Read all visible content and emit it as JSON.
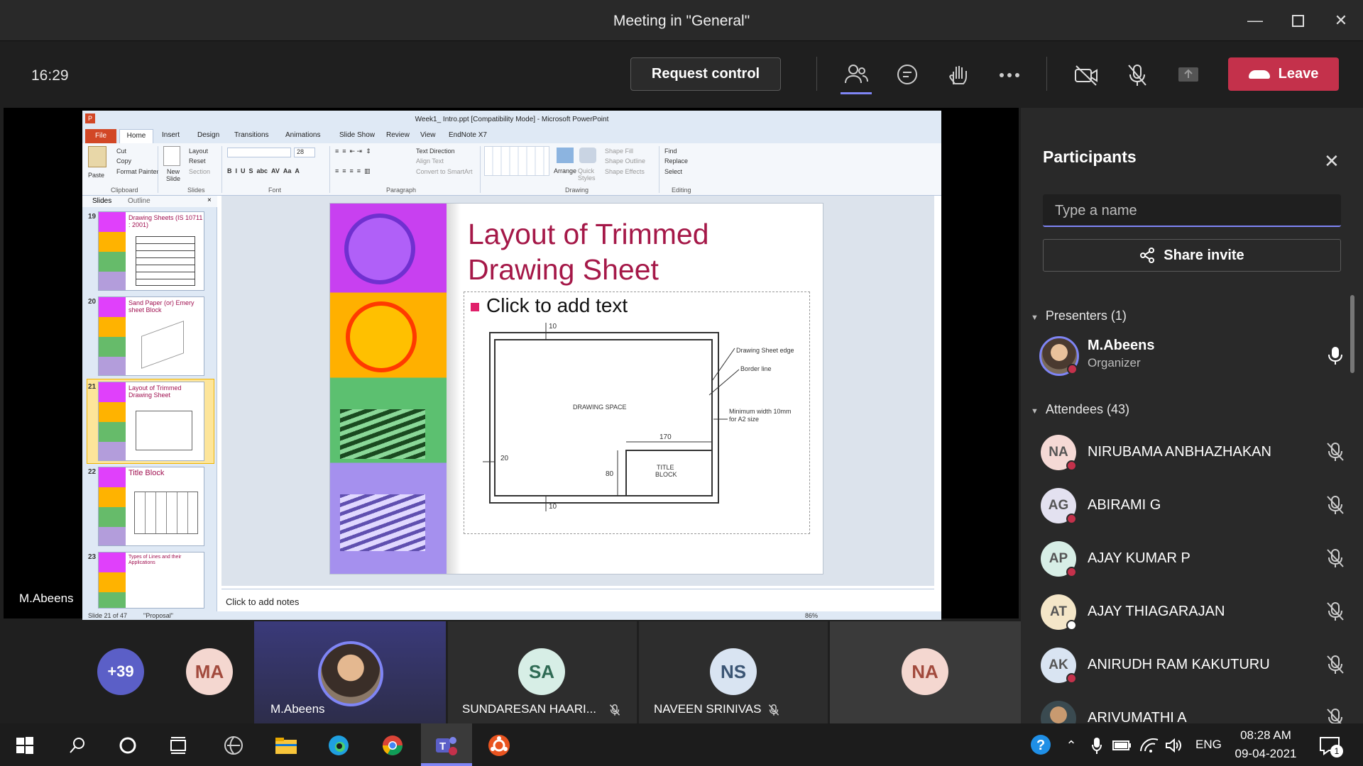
{
  "window": {
    "title": "Meeting in \"General\""
  },
  "toolbar": {
    "time": "16:29",
    "request_control": "Request control",
    "leave": "Leave"
  },
  "stage": {
    "presenter_label": "M.Abeens"
  },
  "ppt": {
    "window_title": "Week1_ Intro.ppt [Compatibility Mode] - Microsoft PowerPoint",
    "tabs": [
      "File",
      "Home",
      "Insert",
      "Design",
      "Transitions",
      "Animations",
      "Slide Show",
      "Review",
      "View",
      "EndNote X7"
    ],
    "ribbon": {
      "paste": "Paste",
      "cut": "Cut",
      "copy": "Copy",
      "format_painter": "Format Painter",
      "new_slide": "New Slide",
      "layout": "Layout",
      "reset": "Reset",
      "section": "Section",
      "font_size": "28",
      "text_direction": "Text Direction",
      "align_text": "Align Text",
      "convert_smartart": "Convert to SmartArt",
      "arrange": "Arrange",
      "quick_styles": "Quick Styles",
      "shape_fill": "Shape Fill",
      "shape_outline": "Shape Outline",
      "shape_effects": "Shape Effects",
      "find": "Find",
      "replace": "Replace",
      "select": "Select",
      "groups": {
        "clipboard": "Clipboard",
        "slides": "Slides",
        "font": "Font",
        "paragraph": "Paragraph",
        "drawing": "Drawing",
        "editing": "Editing"
      }
    },
    "panel_tabs": {
      "slides": "Slides",
      "outline": "Outline"
    },
    "thumbs": [
      {
        "num": "19",
        "title": "Drawing Sheets (IS 10711 : 2001)"
      },
      {
        "num": "20",
        "title": "Sand Paper (or) Emery sheet Block"
      },
      {
        "num": "21",
        "title": "Layout of Trimmed Drawing Sheet"
      },
      {
        "num": "22",
        "title": "Title Block"
      },
      {
        "num": "23",
        "title": "Types of Lines and their Applications"
      }
    ],
    "slide": {
      "title_line1": "Layout of Trimmed",
      "title_line2": "Drawing Sheet",
      "bullet": "Click to add text",
      "drawing": {
        "top_margin": "10",
        "bottom_margin": "10",
        "left_margin": "20",
        "space": "DRAWING SPACE",
        "edge": "Drawing Sheet edge",
        "border": "Border line",
        "min_width_1": "Minimum width 10mm",
        "min_width_2": "for A2 size",
        "title_block_1": "TITLE",
        "title_block_2": "BLOCK",
        "tb_width": "170",
        "tb_height": "80"
      }
    },
    "notes": "Click to add notes",
    "status_slide": "Slide 21 of 47",
    "status_theme": "\"Proposal\"",
    "zoom": "86%"
  },
  "participants": {
    "header": "Participants",
    "search_placeholder": "Type a name",
    "share_invite": "Share invite",
    "presenters_label": "Presenters (1)",
    "presenter": {
      "name": "M.Abeens",
      "role": "Organizer"
    },
    "attendees_label": "Attendees (43)",
    "attendees": [
      {
        "initials": "NA",
        "name": "NIRUBAMA ANBHAZHAKAN",
        "color": "#f5d9d5",
        "status": "#c4314b"
      },
      {
        "initials": "AG",
        "name": "ABIRAMI G",
        "color": "#e3e1f0",
        "status": "#c4314b"
      },
      {
        "initials": "AP",
        "name": "AJAY KUMAR P",
        "color": "#d7eee6",
        "status": "#c4314b"
      },
      {
        "initials": "AT",
        "name": "AJAY THIAGARAJAN",
        "color": "#f4e6c8",
        "status": "#ffffff"
      },
      {
        "initials": "AK",
        "name": "ANIRUDH RAM KAKUTURU",
        "color": "#d9e4f2",
        "status": "#c4314b"
      },
      {
        "initials": "",
        "name": "ARIVUMATHI A",
        "color": "#556",
        "status": ""
      }
    ]
  },
  "strip": {
    "more": "+39",
    "ma": "MA",
    "abeens_name": "M.Abeens",
    "sa": "SA",
    "sa_name": "SUNDARESAN HAARI...",
    "ns": "NS",
    "ns_name": "NAVEEN SRINIVAS",
    "na": "NA"
  },
  "taskbar": {
    "lang": "ENG",
    "time": "08:28 AM",
    "date": "09-04-2021",
    "notifications": "1"
  }
}
